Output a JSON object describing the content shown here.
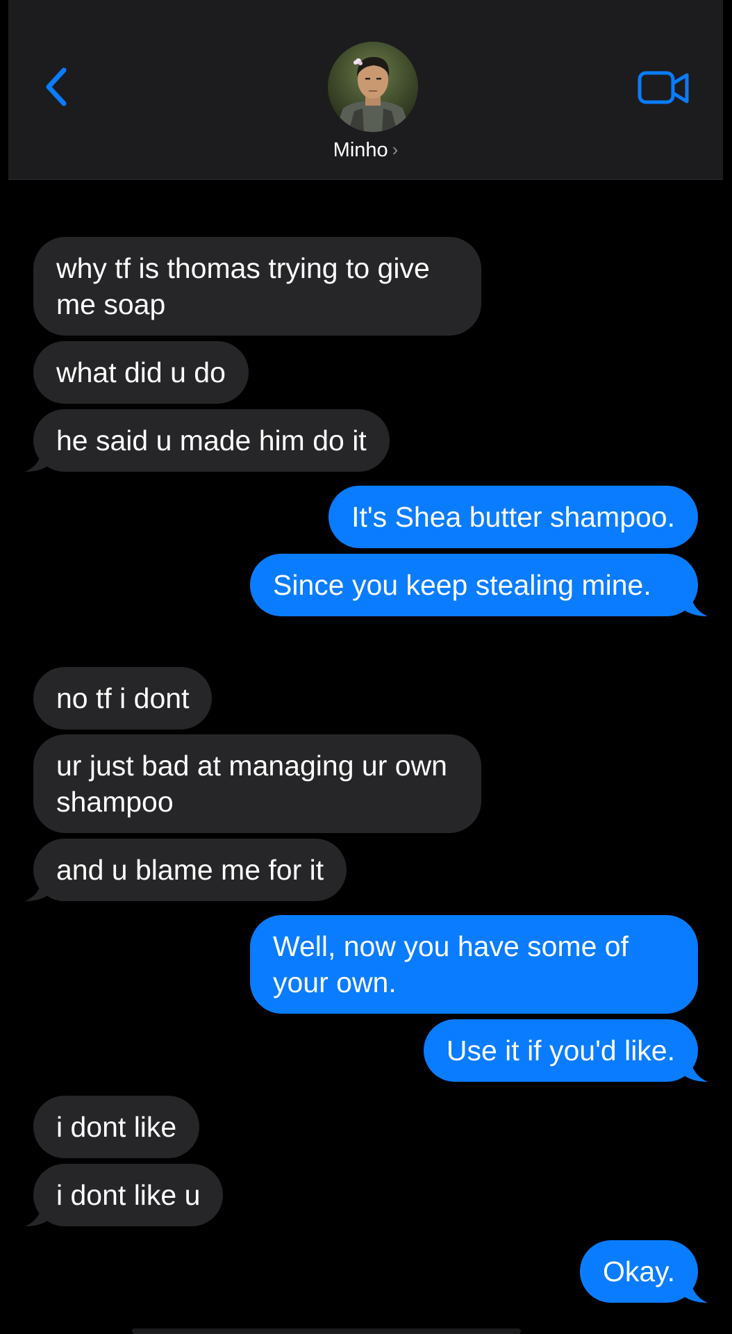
{
  "header": {
    "contact_name": "Minho",
    "colors": {
      "accent": "#0a7cff",
      "header_bg": "#1c1c1e",
      "incoming_bubble": "#262628",
      "outgoing_bubble": "#0a7cff"
    },
    "icons": {
      "back": "chevron-left-icon",
      "video": "video-camera-icon",
      "name_chevron": "chevron-right-icon"
    }
  },
  "messages": [
    {
      "from": "them",
      "text": "why tf is thomas trying to give me soap"
    },
    {
      "from": "them",
      "text": "what did u do"
    },
    {
      "from": "them",
      "text": "he said u made him do it"
    },
    {
      "from": "me",
      "text": "It's Shea butter shampoo."
    },
    {
      "from": "me",
      "text": "Since you keep stealing mine."
    },
    {
      "from": "them",
      "text": "no tf i dont"
    },
    {
      "from": "them",
      "text": "ur just bad at managing ur own shampoo"
    },
    {
      "from": "them",
      "text": "and u blame me for it"
    },
    {
      "from": "me",
      "text": "Well, now you have some of your own."
    },
    {
      "from": "me",
      "text": "Use it if you'd like."
    },
    {
      "from": "them",
      "text": "i dont like"
    },
    {
      "from": "them",
      "text": "i dont like u"
    },
    {
      "from": "me",
      "text": "Okay."
    }
  ]
}
